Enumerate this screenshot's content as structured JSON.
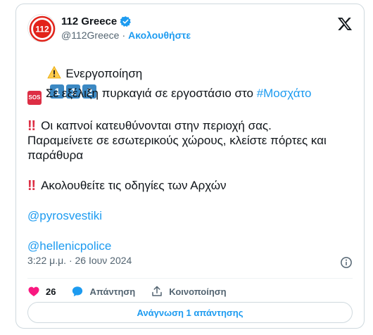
{
  "account": {
    "name": "112 Greece",
    "handle": "@112Greece",
    "separator": "·",
    "follow_label": "Ακολουθήστε",
    "avatar_text": "112",
    "verified": true,
    "brand_color": "#e2231a"
  },
  "tweet": {
    "line1_text": "Ενεργοποίηση",
    "line1_keycaps": [
      "1",
      "1",
      "2"
    ],
    "line2_prefix": "Σε εξέλιξη πυρκαγιά σε εργοστάσιο στο",
    "line2_hashtag": "#Μοσχάτο",
    "sos_label": "SOS",
    "line3_text": "Οι καπνοί κατευθύνονται στην περιοχή σας.",
    "line4_text": "Παραμείνετε σε εσωτερικούς χώρους, κλείστε πόρτες και",
    "line5_text": "παράθυρα",
    "line6_text": "Ακολουθείτε τις οδηγίες των Αρχών",
    "mention1": "@pyrosvestiki",
    "mention2": "@hellenicpolice",
    "bang_glyph": "‼",
    "warning_icon": "warning-icon"
  },
  "meta": {
    "timestamp": "3:22 μ.μ. · 26 Ιουν 2024"
  },
  "actions": {
    "like_count": "26",
    "reply_label": "Απάντηση",
    "share_label": "Κοινοποίηση"
  },
  "replies_button_label": "Ανάγνωση 1 απάντησης",
  "colors": {
    "link": "#1d9bf0",
    "like": "#f91880",
    "text": "#0f1419",
    "muted": "#536471"
  }
}
